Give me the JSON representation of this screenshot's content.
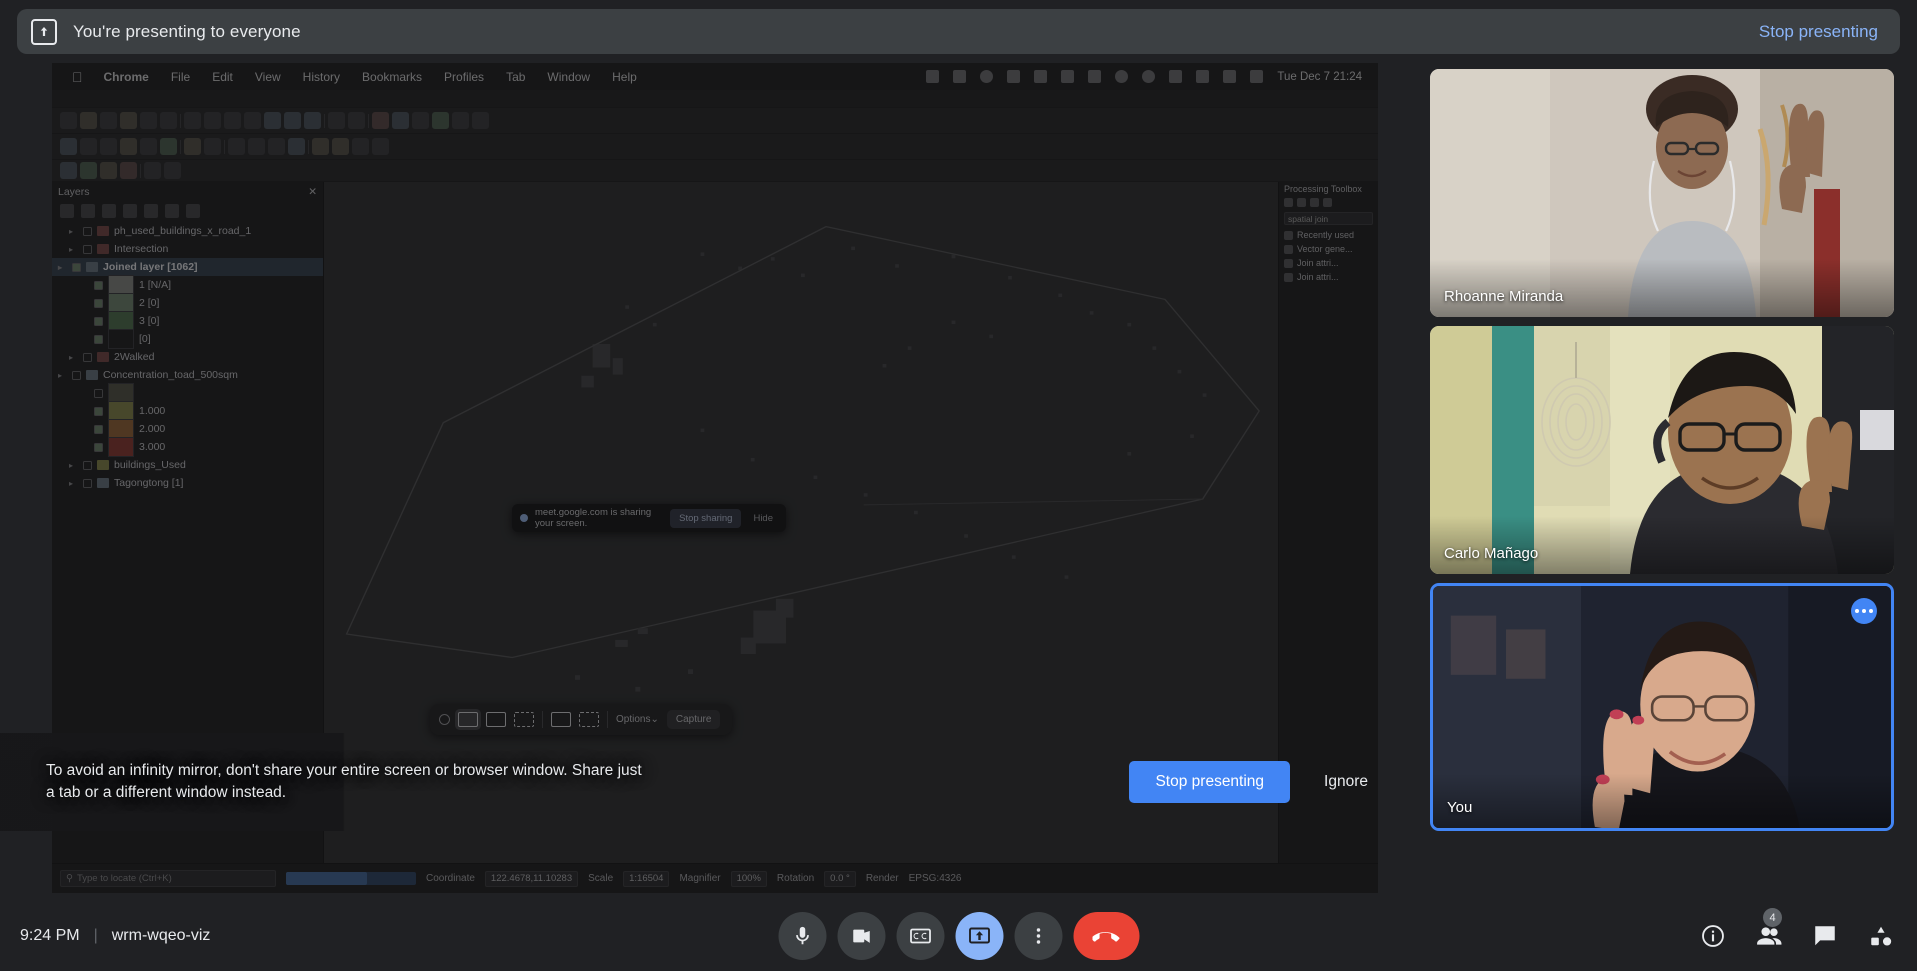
{
  "present_bar": {
    "icon": "present-screen-icon",
    "message": "You're presenting to everyone",
    "stop_link": "Stop presenting"
  },
  "warning": {
    "text": "To avoid an infinity mirror, don't share your entire screen or browser window. Share just a tab or a different window instead.",
    "primary_button": "Stop presenting",
    "ghost_button": "Ignore"
  },
  "meeting": {
    "time": "9:24 PM",
    "separator": "|",
    "code": "wrm-wqeo-viz"
  },
  "controls": [
    {
      "name": "microphone-button",
      "label": "Microphone",
      "icon": "mic-icon",
      "state": "on"
    },
    {
      "name": "camera-button",
      "label": "Camera",
      "icon": "video-camera-icon",
      "state": "on"
    },
    {
      "name": "captions-button",
      "label": "Turn on captions",
      "icon": "closed-captions-icon",
      "state": "off"
    },
    {
      "name": "present-button",
      "label": "Present now",
      "icon": "present-screen-icon",
      "state": "active"
    },
    {
      "name": "more-options-button",
      "label": "More options",
      "icon": "vertical-dots-icon",
      "state": "off"
    },
    {
      "name": "leave-call-button",
      "label": "Leave call",
      "icon": "phone-hangup-icon",
      "state": "danger"
    }
  ],
  "right_icons": [
    {
      "name": "meeting-details-button",
      "label": "Meeting details",
      "icon": "info-circle-icon",
      "badge": ""
    },
    {
      "name": "people-button",
      "label": "Show everyone",
      "icon": "people-icon",
      "badge": "4"
    },
    {
      "name": "chat-button",
      "label": "Chat with everyone",
      "icon": "chat-bubble-icon",
      "badge": ""
    },
    {
      "name": "activities-button",
      "label": "Activities",
      "icon": "activities-shapes-icon",
      "badge": ""
    }
  ],
  "participants": [
    {
      "name": "Rhoanne Miranda",
      "is_self": false,
      "has_more_button": false
    },
    {
      "name": "Carlo Mañago",
      "is_self": false,
      "has_more_button": false
    },
    {
      "name": "You",
      "is_self": true,
      "has_more_button": true
    }
  ],
  "shared_screen": {
    "mac_menu": [
      "Chrome",
      "File",
      "Edit",
      "View",
      "History",
      "Bookmarks",
      "Profiles",
      "Tab",
      "Window",
      "Help"
    ],
    "mac_clock": "Tue Dec 7  21:24",
    "layers_panel": {
      "title": "Layers",
      "items": [
        {
          "label": "ph_used_buildings_x_road_1",
          "type": "layer",
          "indent": 1,
          "checked": false,
          "selected": false,
          "swatch": "#8b4a4a"
        },
        {
          "label": "Intersection",
          "type": "layer",
          "indent": 1,
          "checked": false,
          "selected": false,
          "swatch": "#8b4a4a"
        },
        {
          "label": "Joined layer [1062]",
          "type": "layer",
          "indent": 0,
          "checked": true,
          "selected": true,
          "swatch": "#6a7a8a"
        },
        {
          "label": "1 [N/A]",
          "type": "class",
          "indent": 2,
          "checked": true,
          "selected": false,
          "swatch": "#878a86"
        },
        {
          "label": "2 [0]",
          "type": "class",
          "indent": 2,
          "checked": true,
          "selected": false,
          "swatch": "#6f8a6f"
        },
        {
          "label": "3 [0]",
          "type": "class",
          "indent": 2,
          "checked": true,
          "selected": false,
          "swatch": "#4e7a4e"
        },
        {
          "label": "[0]",
          "type": "class",
          "indent": 2,
          "checked": true,
          "selected": false,
          "swatch": "#2b2b2e"
        },
        {
          "label": "2Walked",
          "type": "layer",
          "indent": 1,
          "checked": false,
          "selected": false,
          "swatch": "#8b4a4a"
        },
        {
          "label": "Concentration_toad_500sqm",
          "type": "layer",
          "indent": 0,
          "checked": false,
          "selected": false,
          "swatch": "#6a7a8a"
        },
        {
          "label": "",
          "type": "class",
          "indent": 2,
          "checked": false,
          "selected": false,
          "swatch": "#5a5a4a"
        },
        {
          "label": "1.000",
          "type": "class",
          "indent": 2,
          "checked": true,
          "selected": false,
          "swatch": "#8b8b3c"
        },
        {
          "label": "2.000",
          "type": "class",
          "indent": 2,
          "checked": true,
          "selected": false,
          "swatch": "#a8662e"
        },
        {
          "label": "3.000",
          "type": "class",
          "indent": 2,
          "checked": true,
          "selected": false,
          "swatch": "#a83b33"
        },
        {
          "label": "buildings_Used",
          "type": "layer",
          "indent": 1,
          "checked": false,
          "selected": false,
          "swatch": "#8b8b3c"
        },
        {
          "label": "Tagongtong [1]",
          "type": "layer",
          "indent": 1,
          "checked": false,
          "selected": false,
          "swatch": "#6a7a8a"
        }
      ]
    },
    "processing_panel": {
      "title": "Processing Toolbox",
      "search_value": "spatial join",
      "items": [
        "Recently used",
        "Vector gene...",
        "Join attri...",
        "Join attri..."
      ]
    },
    "status_bar": {
      "locator_placeholder": "Type to locate (Ctrl+K)",
      "coordinate_label": "Coordinate",
      "coordinate_value": "122.4678,11.10283",
      "scale_label": "Scale",
      "scale_value": "1:16504",
      "magnifier_label": "Magnifier",
      "magnifier_value": "100%",
      "rotation_label": "Rotation",
      "rotation_value": "0.0 °",
      "render_label": "Render",
      "crs_value": "EPSG:4326"
    },
    "chrome_notification": {
      "text": "meet.google.com is sharing your screen.",
      "stop_button": "Stop sharing",
      "hide_button": "Hide"
    },
    "capture_toolbar": {
      "options_label": "Options",
      "options_caret": "⌄",
      "capture_label": "Capture",
      "modes": [
        "capture-entire-screen-icon",
        "capture-window-icon",
        "capture-selection-icon",
        "record-screen-icon",
        "record-selection-icon"
      ]
    }
  },
  "colors": {
    "accent": "#4285f4",
    "link": "#8ab4f8",
    "danger": "#ea4335",
    "surface": "#202124",
    "surface_light": "#3c4043"
  }
}
